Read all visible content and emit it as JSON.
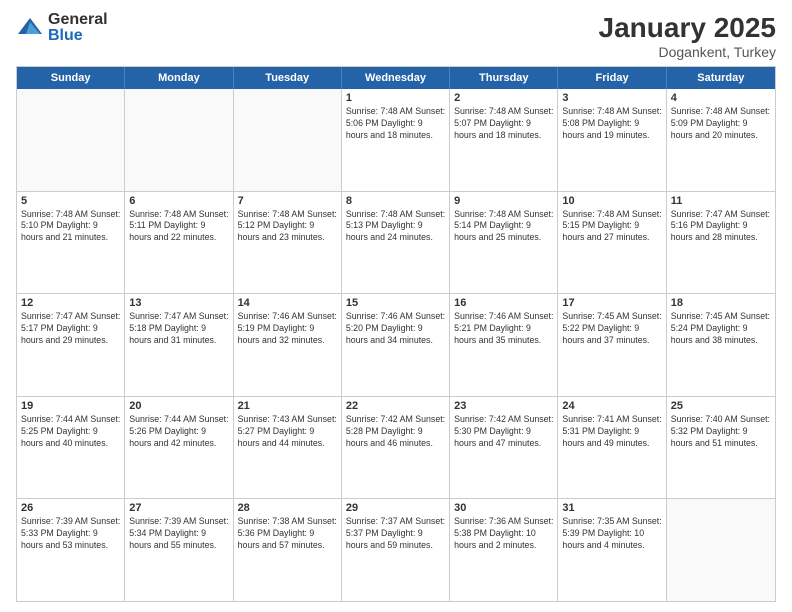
{
  "logo": {
    "general": "General",
    "blue": "Blue"
  },
  "title": {
    "month": "January 2025",
    "location": "Dogankent, Turkey"
  },
  "header_days": [
    "Sunday",
    "Monday",
    "Tuesday",
    "Wednesday",
    "Thursday",
    "Friday",
    "Saturday"
  ],
  "rows": [
    [
      {
        "day": "",
        "info": "",
        "empty": true
      },
      {
        "day": "",
        "info": "",
        "empty": true
      },
      {
        "day": "",
        "info": "",
        "empty": true
      },
      {
        "day": "1",
        "info": "Sunrise: 7:48 AM\nSunset: 5:06 PM\nDaylight: 9 hours\nand 18 minutes.",
        "empty": false
      },
      {
        "day": "2",
        "info": "Sunrise: 7:48 AM\nSunset: 5:07 PM\nDaylight: 9 hours\nand 18 minutes.",
        "empty": false
      },
      {
        "day": "3",
        "info": "Sunrise: 7:48 AM\nSunset: 5:08 PM\nDaylight: 9 hours\nand 19 minutes.",
        "empty": false
      },
      {
        "day": "4",
        "info": "Sunrise: 7:48 AM\nSunset: 5:09 PM\nDaylight: 9 hours\nand 20 minutes.",
        "empty": false
      }
    ],
    [
      {
        "day": "5",
        "info": "Sunrise: 7:48 AM\nSunset: 5:10 PM\nDaylight: 9 hours\nand 21 minutes.",
        "empty": false
      },
      {
        "day": "6",
        "info": "Sunrise: 7:48 AM\nSunset: 5:11 PM\nDaylight: 9 hours\nand 22 minutes.",
        "empty": false
      },
      {
        "day": "7",
        "info": "Sunrise: 7:48 AM\nSunset: 5:12 PM\nDaylight: 9 hours\nand 23 minutes.",
        "empty": false
      },
      {
        "day": "8",
        "info": "Sunrise: 7:48 AM\nSunset: 5:13 PM\nDaylight: 9 hours\nand 24 minutes.",
        "empty": false
      },
      {
        "day": "9",
        "info": "Sunrise: 7:48 AM\nSunset: 5:14 PM\nDaylight: 9 hours\nand 25 minutes.",
        "empty": false
      },
      {
        "day": "10",
        "info": "Sunrise: 7:48 AM\nSunset: 5:15 PM\nDaylight: 9 hours\nand 27 minutes.",
        "empty": false
      },
      {
        "day": "11",
        "info": "Sunrise: 7:47 AM\nSunset: 5:16 PM\nDaylight: 9 hours\nand 28 minutes.",
        "empty": false
      }
    ],
    [
      {
        "day": "12",
        "info": "Sunrise: 7:47 AM\nSunset: 5:17 PM\nDaylight: 9 hours\nand 29 minutes.",
        "empty": false
      },
      {
        "day": "13",
        "info": "Sunrise: 7:47 AM\nSunset: 5:18 PM\nDaylight: 9 hours\nand 31 minutes.",
        "empty": false
      },
      {
        "day": "14",
        "info": "Sunrise: 7:46 AM\nSunset: 5:19 PM\nDaylight: 9 hours\nand 32 minutes.",
        "empty": false
      },
      {
        "day": "15",
        "info": "Sunrise: 7:46 AM\nSunset: 5:20 PM\nDaylight: 9 hours\nand 34 minutes.",
        "empty": false
      },
      {
        "day": "16",
        "info": "Sunrise: 7:46 AM\nSunset: 5:21 PM\nDaylight: 9 hours\nand 35 minutes.",
        "empty": false
      },
      {
        "day": "17",
        "info": "Sunrise: 7:45 AM\nSunset: 5:22 PM\nDaylight: 9 hours\nand 37 minutes.",
        "empty": false
      },
      {
        "day": "18",
        "info": "Sunrise: 7:45 AM\nSunset: 5:24 PM\nDaylight: 9 hours\nand 38 minutes.",
        "empty": false
      }
    ],
    [
      {
        "day": "19",
        "info": "Sunrise: 7:44 AM\nSunset: 5:25 PM\nDaylight: 9 hours\nand 40 minutes.",
        "empty": false
      },
      {
        "day": "20",
        "info": "Sunrise: 7:44 AM\nSunset: 5:26 PM\nDaylight: 9 hours\nand 42 minutes.",
        "empty": false
      },
      {
        "day": "21",
        "info": "Sunrise: 7:43 AM\nSunset: 5:27 PM\nDaylight: 9 hours\nand 44 minutes.",
        "empty": false
      },
      {
        "day": "22",
        "info": "Sunrise: 7:42 AM\nSunset: 5:28 PM\nDaylight: 9 hours\nand 46 minutes.",
        "empty": false
      },
      {
        "day": "23",
        "info": "Sunrise: 7:42 AM\nSunset: 5:30 PM\nDaylight: 9 hours\nand 47 minutes.",
        "empty": false
      },
      {
        "day": "24",
        "info": "Sunrise: 7:41 AM\nSunset: 5:31 PM\nDaylight: 9 hours\nand 49 minutes.",
        "empty": false
      },
      {
        "day": "25",
        "info": "Sunrise: 7:40 AM\nSunset: 5:32 PM\nDaylight: 9 hours\nand 51 minutes.",
        "empty": false
      }
    ],
    [
      {
        "day": "26",
        "info": "Sunrise: 7:39 AM\nSunset: 5:33 PM\nDaylight: 9 hours\nand 53 minutes.",
        "empty": false
      },
      {
        "day": "27",
        "info": "Sunrise: 7:39 AM\nSunset: 5:34 PM\nDaylight: 9 hours\nand 55 minutes.",
        "empty": false
      },
      {
        "day": "28",
        "info": "Sunrise: 7:38 AM\nSunset: 5:36 PM\nDaylight: 9 hours\nand 57 minutes.",
        "empty": false
      },
      {
        "day": "29",
        "info": "Sunrise: 7:37 AM\nSunset: 5:37 PM\nDaylight: 9 hours\nand 59 minutes.",
        "empty": false
      },
      {
        "day": "30",
        "info": "Sunrise: 7:36 AM\nSunset: 5:38 PM\nDaylight: 10 hours\nand 2 minutes.",
        "empty": false
      },
      {
        "day": "31",
        "info": "Sunrise: 7:35 AM\nSunset: 5:39 PM\nDaylight: 10 hours\nand 4 minutes.",
        "empty": false
      },
      {
        "day": "",
        "info": "",
        "empty": true
      }
    ]
  ]
}
